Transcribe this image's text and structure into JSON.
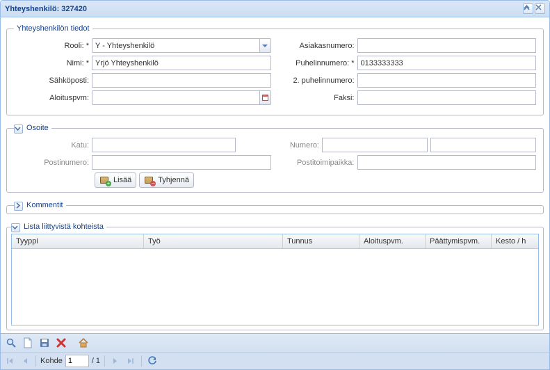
{
  "header": {
    "title": "Yhteyshenkilö: 327420"
  },
  "fs_details": {
    "legend": "Yhteyshenkilön tiedot",
    "rooli_label": "Rooli: *",
    "rooli_value": "Y - Yhteyshenkilö",
    "asiakasnumero_label": "Asiakasnumero:",
    "asiakasnumero_value": "",
    "nimi_label": "Nimi: *",
    "nimi_value": "Yrjö Yhteyshenkilö",
    "puhelin_label": "Puhelinnumero: *",
    "puhelin_value": "0133333333",
    "email_label": "Sähköposti:",
    "email_value": "",
    "puhelin2_label": "2. puhelinnumero:",
    "puhelin2_value": "",
    "aloitus_label": "Aloituspvm:",
    "aloitus_value": "",
    "faksi_label": "Faksi:",
    "faksi_value": ""
  },
  "fs_address": {
    "legend": "Osoite",
    "katu_label": "Katu:",
    "katu_value": "",
    "numero_label": "Numero:",
    "numero_value1": "",
    "numero_value2": "",
    "postinumero_label": "Postinumero:",
    "postinumero_value": "",
    "postitoimipaikka_label": "Postitoimipaikka:",
    "postitoimipaikka_value": "",
    "btn_add": "Lisää",
    "btn_clear": "Tyhjennä"
  },
  "fs_comments": {
    "legend": "Kommentit"
  },
  "fs_list": {
    "legend": "Lista liittyvistä kohteista",
    "columns": [
      "Tyyppi",
      "Työ",
      "Tunnus",
      "Aloituspvm.",
      "Päättymispvm.",
      "Kesto / h"
    ],
    "rows": []
  },
  "paging": {
    "label": "Kohde",
    "page": "1",
    "total": "/ 1"
  }
}
